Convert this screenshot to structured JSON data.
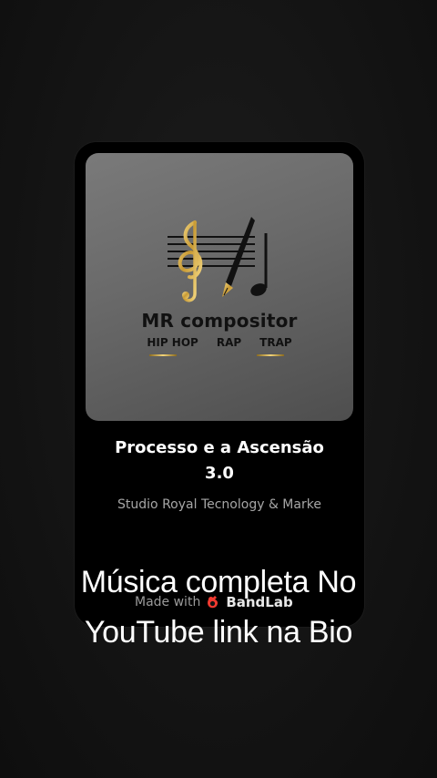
{
  "cover": {
    "logo_name": "MR compositor",
    "logo_tags": [
      "HIP HOP",
      "RAP",
      "TRAP"
    ],
    "logo_colors": {
      "gold": "#d8b24a",
      "ink": "#111111"
    },
    "icons": [
      "treble-clef-icon",
      "music-note-icon",
      "fountain-pen-icon"
    ]
  },
  "track": {
    "title_line1": "Processo e a Ascensão",
    "title_line2": "3.0",
    "artist": "Studio Royal Tecnology & Marke"
  },
  "watermark": {
    "prefix": "Made with",
    "brand": "BandLab",
    "brand_color": "#f23a30",
    "icon": "bandlab-logo-icon"
  },
  "caption": {
    "line1": "Música completa No",
    "line2": "YouTube link na Bio"
  }
}
